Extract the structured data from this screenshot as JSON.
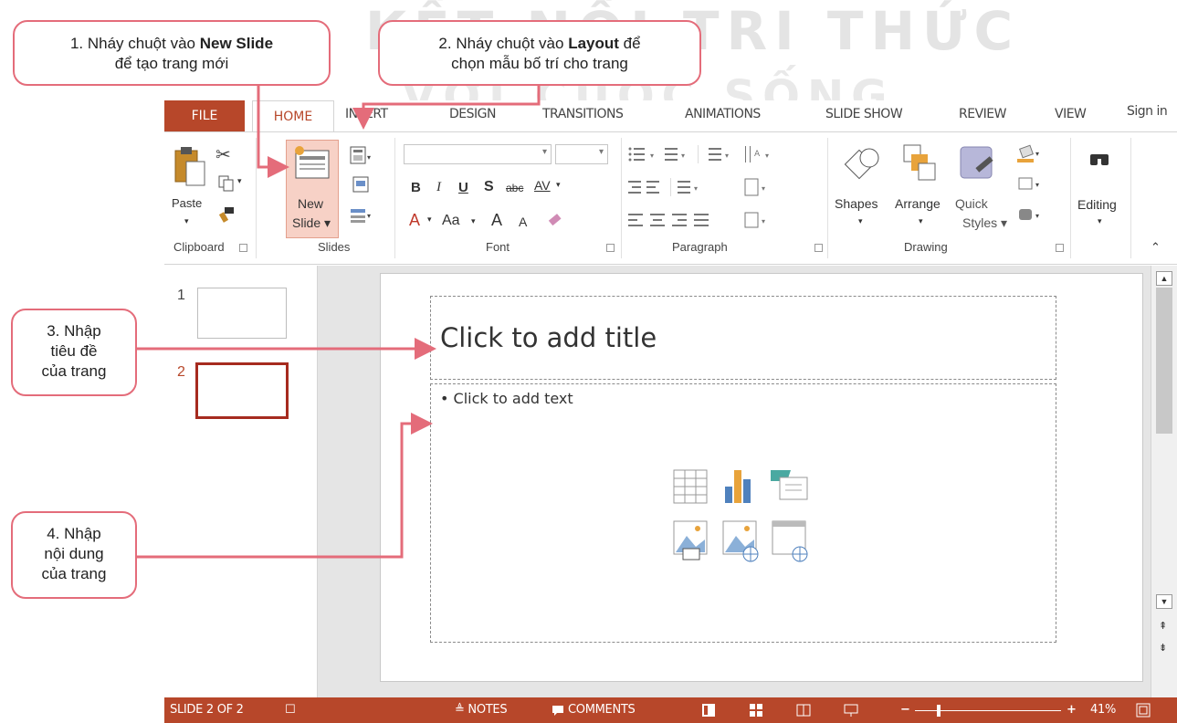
{
  "watermark": {
    "line1": "KẾT NỐI TRI THỨC",
    "line2": "VỚI CUỘC SỐNG"
  },
  "callouts": {
    "c1": {
      "line1_prefix": "1. Nháy chuột vào ",
      "line1_bold": "New Slide",
      "line2": "để tạo trang mới"
    },
    "c2": {
      "line1_prefix": "2. Nháy chuột vào ",
      "line1_bold": "Layout",
      "line1_suffix": " để",
      "line2": "chọn mẫu bố trí cho trang"
    },
    "c3": {
      "line1": "3. Nhập",
      "line2": "tiêu đề",
      "line3": "của trang"
    },
    "c4": {
      "line1": "4. Nhập",
      "line2": "nội dung",
      "line3": "của trang"
    }
  },
  "tabs": {
    "file": "FILE",
    "home": "HOME",
    "insert": "INSERT",
    "design": "DESIGN",
    "transitions": "TRANSITIONS",
    "animations": "ANIMATIONS",
    "slideshow": "SLIDE SHOW",
    "review": "REVIEW",
    "view": "VIEW",
    "signin": "Sign in"
  },
  "ribbon": {
    "clipboard": {
      "label": "Clipboard",
      "paste": "Paste"
    },
    "slides": {
      "label": "Slides",
      "new_slide_1": "New",
      "new_slide_2": "Slide ▾"
    },
    "font": {
      "label": "Font",
      "bold": "B",
      "italic": "I",
      "underline": "U",
      "shadow": "S",
      "strike": "abc",
      "spacing": "AV",
      "color": "A",
      "case": "Aa",
      "grow": "A",
      "shrink": "A"
    },
    "paragraph": {
      "label": "Paragraph"
    },
    "drawing": {
      "label": "Drawing",
      "shapes": "Shapes",
      "arrange": "Arrange",
      "quick": "Quick",
      "styles": "Styles ▾"
    },
    "editing": {
      "label": "Editing"
    }
  },
  "thumbnails": [
    {
      "number": "1"
    },
    {
      "number": "2"
    }
  ],
  "slide": {
    "title_placeholder": "Click to add title",
    "body_placeholder": "• Click to add text"
  },
  "statusbar": {
    "slide_info": "SLIDE 2 OF 2",
    "notes": "≜ NOTES",
    "comments": "COMMENTS",
    "zoom": "41%"
  },
  "colors": {
    "accent": "#b7472a",
    "callout_border": "#e46c7a",
    "arrow": "#e46c7a"
  }
}
